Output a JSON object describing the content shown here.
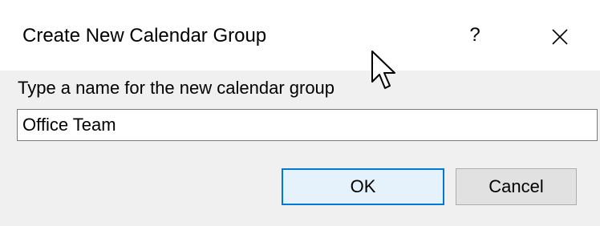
{
  "dialog": {
    "title": "Create New Calendar Group",
    "help_label": "?",
    "prompt_label": "Type a name for the new calendar group",
    "name_value": "Office Team",
    "buttons": {
      "ok_label": "OK",
      "cancel_label": "Cancel"
    }
  },
  "icons": {
    "close": "close-icon",
    "cursor": "mouse-pointer-icon"
  },
  "colors": {
    "dialog_bg": "#f0f0f0",
    "titlebar_bg": "#ffffff",
    "accent": "#0078d7",
    "button_bg": "#e1e1e1"
  }
}
